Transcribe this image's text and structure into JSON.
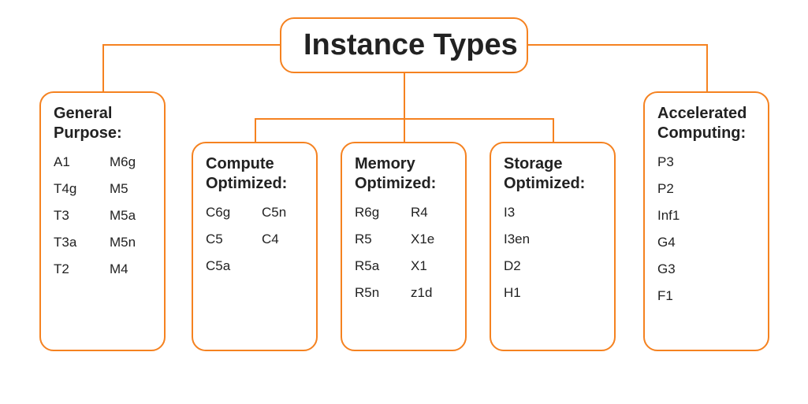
{
  "root": {
    "title": "Instance Types"
  },
  "categories": {
    "general": {
      "title_l1": "General",
      "title_l2": "Purpose:",
      "items": [
        "A1",
        "M6g",
        "T4g",
        "M5",
        "T3",
        "M5a",
        "T3a",
        "M5n",
        "T2",
        "M4"
      ]
    },
    "compute": {
      "title_l1": "Compute",
      "title_l2": "Optimized:",
      "items": [
        "C6g",
        "C5n",
        "C5",
        "C4",
        "C5a"
      ]
    },
    "memory": {
      "title_l1": "Memory",
      "title_l2": "Optimized:",
      "items": [
        "R6g",
        "R4",
        "R5",
        "X1e",
        "R5a",
        "X1",
        "R5n",
        "z1d"
      ]
    },
    "storage": {
      "title_l1": "Storage",
      "title_l2": "Optimized:",
      "items": [
        "I3",
        "I3en",
        "D2",
        "H1"
      ]
    },
    "accelerated": {
      "title_l1": "Accelerated",
      "title_l2": "Computing:",
      "items": [
        "P3",
        "P2",
        "Inf1",
        "G4",
        "G3",
        "F1"
      ]
    }
  },
  "colors": {
    "accent": "#f58220",
    "text": "#222222"
  }
}
